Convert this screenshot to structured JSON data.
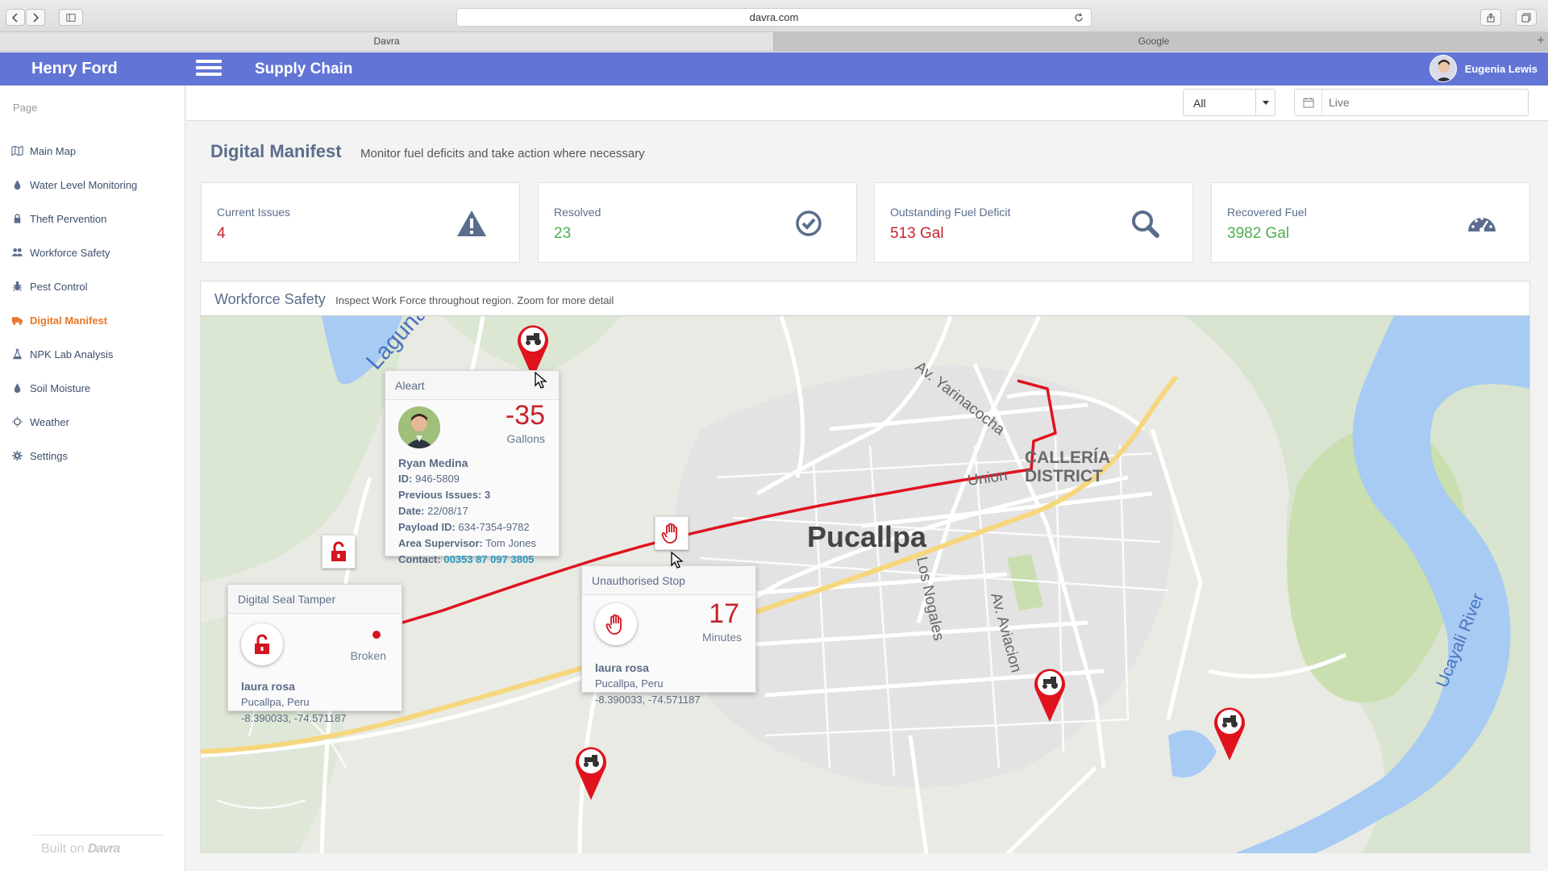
{
  "browser": {
    "url": "davra.com",
    "tabs": [
      {
        "label": "Davra",
        "active": true
      },
      {
        "label": "Google",
        "active": false
      }
    ],
    "new_tab_label": "+"
  },
  "header": {
    "brand": "Henry Ford",
    "title": "Supply Chain",
    "user_name": "Eugenia Lewis",
    "bar_color": "#6275d6"
  },
  "sidebar": {
    "section_label": "Page",
    "items": [
      {
        "label": "Main Map",
        "icon": "map-icon",
        "active": false
      },
      {
        "label": "Water Level Monitoring",
        "icon": "drop-icon",
        "active": false
      },
      {
        "label": "Theft Pervention",
        "icon": "lock-icon",
        "active": false
      },
      {
        "label": "Workforce Safety",
        "icon": "users-icon",
        "active": false
      },
      {
        "label": "Pest Control",
        "icon": "bug-icon",
        "active": false
      },
      {
        "label": "Digital Manifest",
        "icon": "truck-icon",
        "active": true
      },
      {
        "label": "NPK Lab Analysis",
        "icon": "flask-icon",
        "active": false
      },
      {
        "label": "Soil Moisture",
        "icon": "drop-icon",
        "active": false
      },
      {
        "label": "Weather",
        "icon": "sun-icon",
        "active": false
      },
      {
        "label": "Settings",
        "icon": "gear-icon",
        "active": false
      }
    ],
    "footer_text": "Built on",
    "footer_brand": "Davra",
    "active_color": "#e6782a"
  },
  "toolbar": {
    "filter_value": "All",
    "date_placeholder": "Live"
  },
  "page": {
    "title": "Digital Manifest",
    "subtitle": "Monitor fuel deficits and take action where necessary"
  },
  "stats": [
    {
      "label": "Current Issues",
      "value": "4",
      "color": "#c8232c",
      "icon": "warning-icon"
    },
    {
      "label": "Resolved",
      "value": "23",
      "color": "#4caf50",
      "icon": "check-circle-icon"
    },
    {
      "label": "Outstanding Fuel Deficit",
      "value": "513 Gal",
      "color": "#c8232c",
      "icon": "search-icon"
    },
    {
      "label": "Recovered Fuel",
      "value": "3982 Gal",
      "color": "#4caf50",
      "icon": "gauge-icon"
    }
  ],
  "map": {
    "title": "Workforce Safety",
    "subtitle": "Inspect Work Force throughout region. Zoom for more detail",
    "labels": {
      "city": "Pucallpa",
      "district_line1": "CALLERÍA",
      "district_line2": "DISTRICT",
      "lagoon": "Laguna",
      "river": "Ucayali River",
      "road_yarinacocha": "Av. Yarinacocha",
      "road_union": "Union",
      "road_nogales": "Los Nogales",
      "road_aviacion": "Av. Aviacion"
    },
    "route_color": "#e0121e",
    "water_color": "#a7cbf2",
    "park_color": "#c9dfaf"
  },
  "popups": {
    "alert": {
      "title": "Aleart",
      "value": "-35",
      "unit": "Gallons",
      "name": "Ryan Medina",
      "id_label": "ID:",
      "id": "946-5809",
      "prev_label": "Previous Issues:",
      "prev": "3",
      "date_label": "Date:",
      "date": "22/08/17",
      "payload_label": "Payload ID:",
      "payload": "634-7354-9782",
      "supervisor_label": "Area Supervisor:",
      "supervisor": "Tom Jones",
      "contact_label": "Contact:",
      "contact": "00353 87 097 3805"
    },
    "seal": {
      "title": "Digital Seal Tamper",
      "status": "Broken",
      "name": "laura rosa",
      "location": "Pucallpa, Peru",
      "coords": "-8.390033, -74.571187"
    },
    "stop": {
      "title": "Unauthorised Stop",
      "value": "17",
      "unit": "Minutes",
      "name": "laura rosa",
      "location": "Pucallpa, Peru",
      "coords": "-8.390033, -74.571187"
    }
  }
}
